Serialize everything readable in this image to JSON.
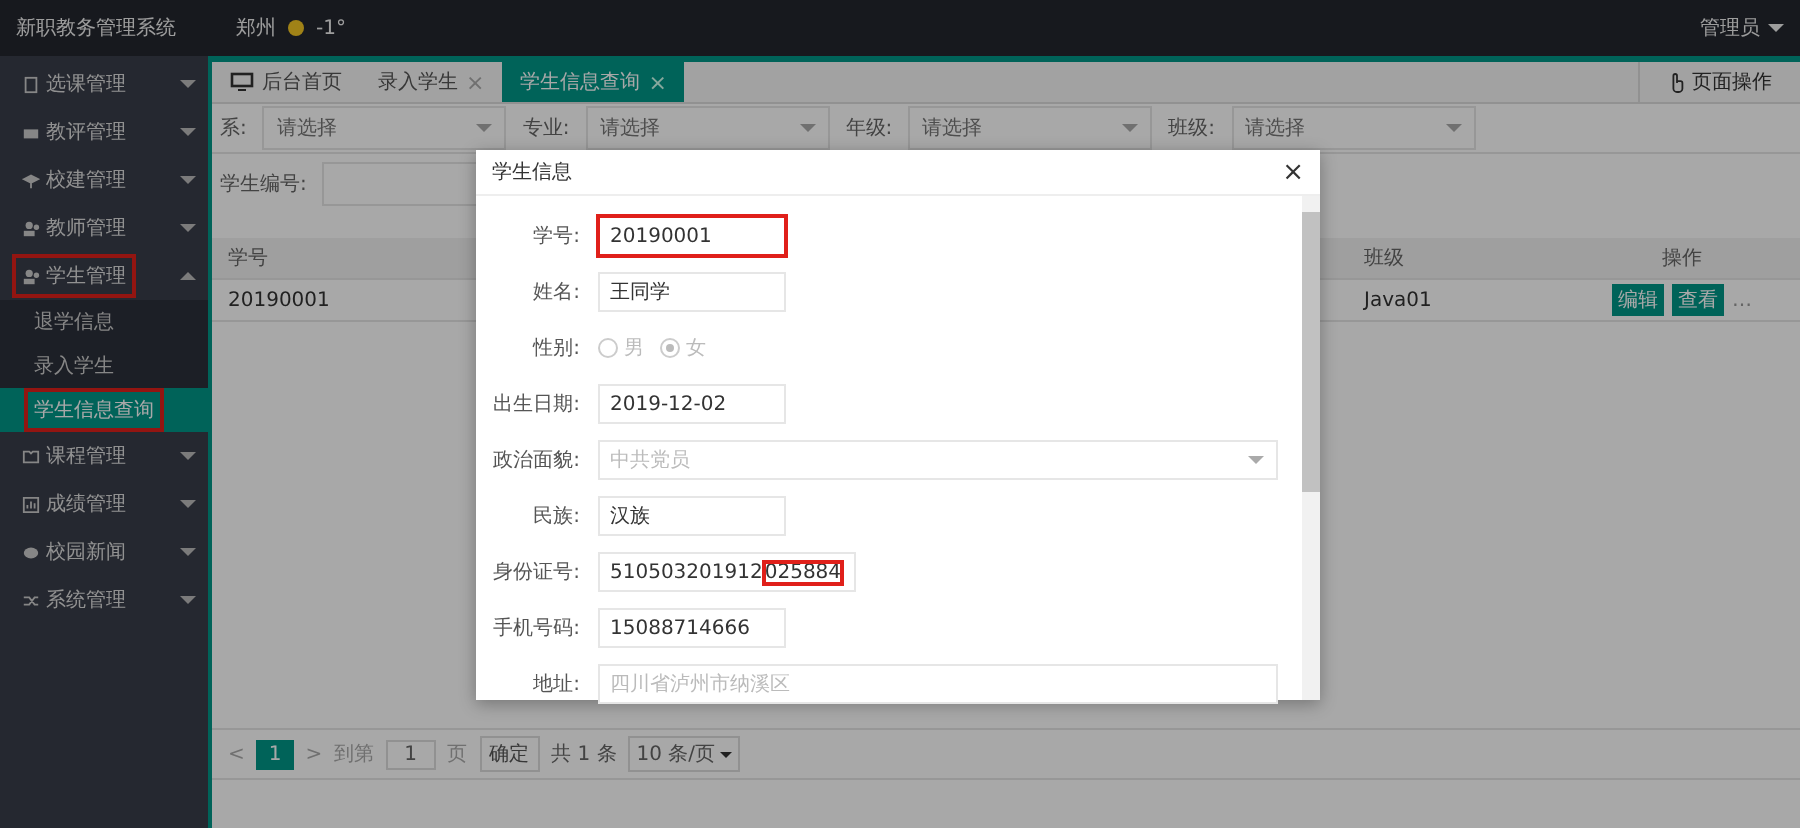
{
  "header": {
    "title": "新职教务管理系统",
    "city": "郑州",
    "temperature": "-1°",
    "user": "管理员"
  },
  "sidebar": {
    "items": [
      {
        "label": "选课管理",
        "kind": "doc",
        "expanded": false,
        "highlighted": false
      },
      {
        "label": "教评管理",
        "kind": "card",
        "expanded": false,
        "highlighted": false
      },
      {
        "label": "校建管理",
        "kind": "pin",
        "expanded": false,
        "highlighted": false
      },
      {
        "label": "教师管理",
        "kind": "people",
        "expanded": false,
        "highlighted": false
      },
      {
        "label": "学生管理",
        "kind": "people",
        "expanded": true,
        "highlighted": true,
        "children": [
          {
            "label": "退学信息",
            "selected": false,
            "highlighted": false
          },
          {
            "label": "录入学生",
            "selected": false,
            "highlighted": false
          },
          {
            "label": "学生信息查询",
            "selected": true,
            "highlighted": true
          }
        ]
      },
      {
        "label": "课程管理",
        "kind": "book",
        "expanded": false,
        "highlighted": false
      },
      {
        "label": "成绩管理",
        "kind": "chart",
        "expanded": false,
        "highlighted": false
      },
      {
        "label": "校园新闻",
        "kind": "chat",
        "expanded": false,
        "highlighted": false
      },
      {
        "label": "系统管理",
        "kind": "shuffle",
        "expanded": false,
        "highlighted": false
      }
    ]
  },
  "tabs": [
    {
      "label": "后台首页",
      "kind": "home",
      "selected": false
    },
    {
      "label": "录入学生",
      "kind": "plain",
      "close": "×",
      "selected": false
    },
    {
      "label": "学生信息查询",
      "kind": "plain",
      "close": "×",
      "selected": true
    }
  ],
  "page_action": "页面操作",
  "filters": [
    {
      "label": "系:",
      "placeholder": "请选择"
    },
    {
      "label": "专业:",
      "placeholder": "请选择"
    },
    {
      "label": "年级:",
      "placeholder": "请选择"
    },
    {
      "label": "班级:",
      "placeholder": "请选择"
    }
  ],
  "search_label": "学生编号:",
  "table": {
    "columns": [
      "学号",
      "班级",
      "操作"
    ],
    "rows": [
      {
        "cells": [
          "20190001",
          "Java01"
        ],
        "actions": [
          "编辑",
          "查看"
        ],
        "more": "…"
      }
    ]
  },
  "pager": {
    "prev": "<",
    "pages": [
      {
        "label": "1",
        "selected": true
      }
    ],
    "next": ">",
    "goto_label": "到第",
    "goto_value": "1",
    "page_unit": "页",
    "confirm": "确定",
    "total": "共 1 条",
    "page_size": "10 条/页"
  },
  "modal": {
    "title": "学生信息",
    "close": "×",
    "fields": [
      {
        "label": "学号:",
        "kind": "text",
        "value": "20190001",
        "highlighted": true
      },
      {
        "label": "姓名:",
        "kind": "text",
        "value": "王同学",
        "highlighted": false
      },
      {
        "label": "性别:",
        "kind": "radio",
        "options": [
          {
            "label": "男",
            "selected": false
          },
          {
            "label": "女",
            "selected": true
          }
        ]
      },
      {
        "label": "出生日期:",
        "kind": "text",
        "value": "2019-12-02",
        "highlighted": false
      },
      {
        "label": "政治面貌:",
        "kind": "select",
        "value": "中共党员",
        "disabled": true
      },
      {
        "label": "民族:",
        "kind": "text",
        "value": "汉族",
        "highlighted": false
      },
      {
        "label": "身份证号:",
        "kind": "text",
        "value": "510503201912",
        "marked": "025884",
        "highlighted": false
      },
      {
        "label": "手机号码:",
        "kind": "text",
        "value": "15088714666",
        "highlighted": false
      },
      {
        "label": "地址:",
        "kind": "wide",
        "placeholder": "四川省泸州市纳溪区"
      }
    ]
  }
}
